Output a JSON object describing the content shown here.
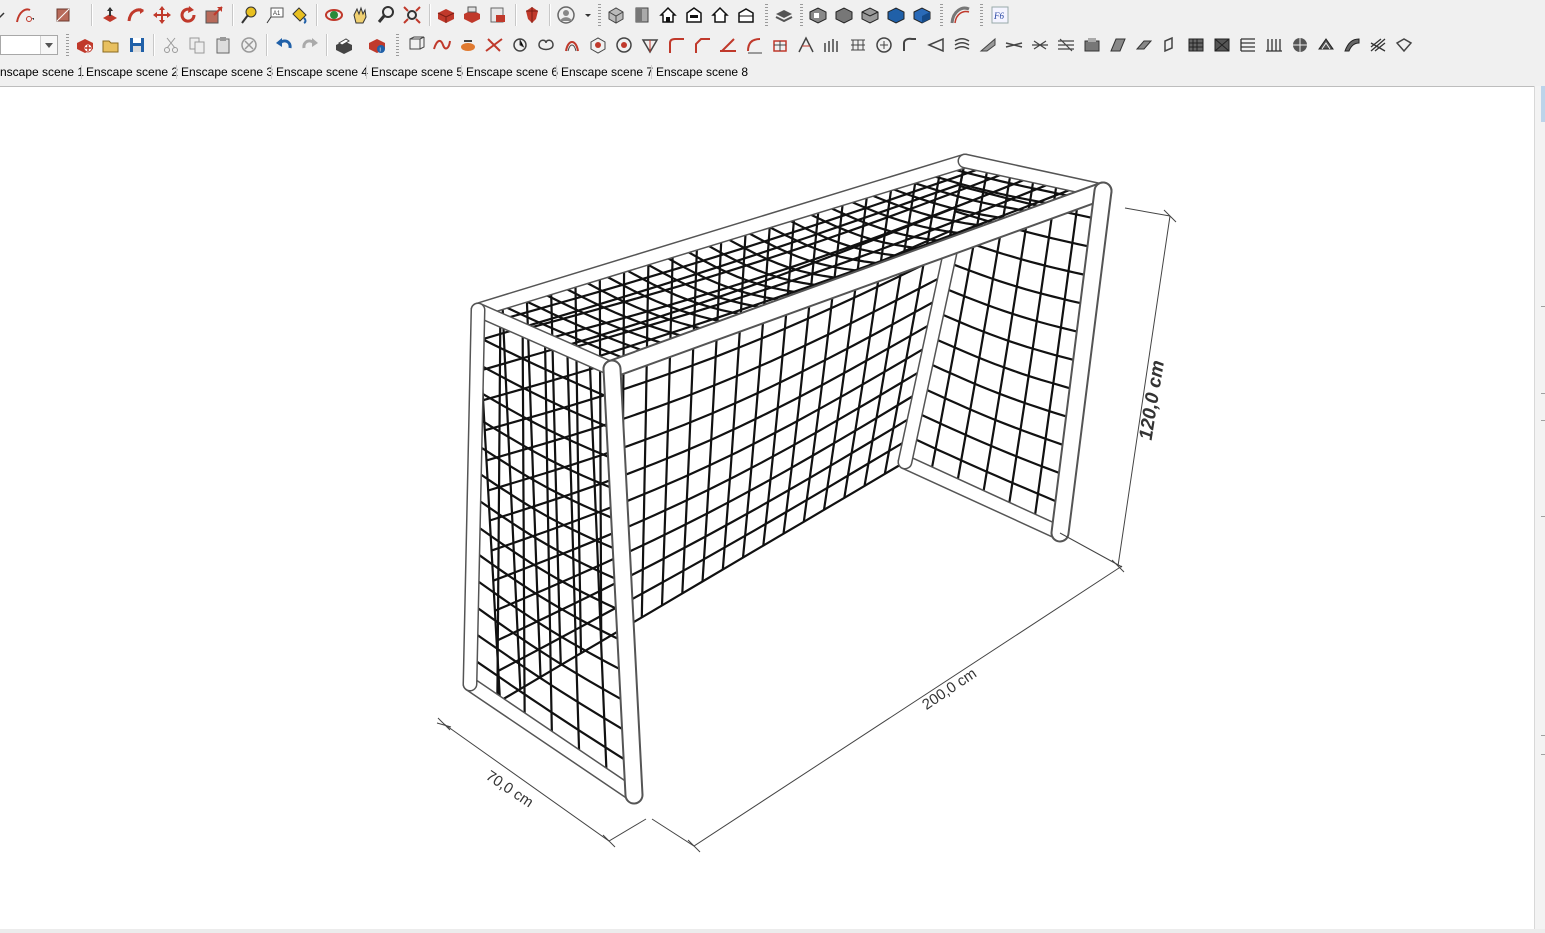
{
  "toolbar_top": {
    "groups": [
      {
        "name": "drawing-tools",
        "icons": [
          "line-dropdown-icon",
          "arc-dropdown-icon",
          "shape-dropdown-icon"
        ]
      },
      {
        "name": "edit-tools",
        "icons": [
          "push-pull-icon",
          "follow-me-icon",
          "move-icon",
          "rotate-icon",
          "scale-icon"
        ]
      },
      {
        "name": "construction-tools",
        "icons": [
          "tape-measure-icon",
          "text-label-icon",
          "paint-bucket-icon"
        ]
      },
      {
        "name": "camera-tools",
        "icons": [
          "orbit-icon",
          "pan-icon",
          "zoom-icon",
          "zoom-extents-icon"
        ]
      },
      {
        "name": "warehouse-tools",
        "icons": [
          "3d-warehouse-icon",
          "extension-warehouse-icon",
          "share-model-icon"
        ]
      },
      {
        "name": "ruby-tools",
        "icons": [
          "ruby-console-icon"
        ]
      },
      {
        "name": "account",
        "icons": [
          "user-account-dropdown-icon"
        ]
      },
      {
        "name": "standard-views",
        "icons": [
          "iso-view-icon",
          "top-view-icon",
          "front-view-icon",
          "right-view-icon",
          "back-view-icon",
          "left-view-icon"
        ]
      },
      {
        "name": "layers",
        "icons": [
          "layers-icon"
        ]
      },
      {
        "name": "styles",
        "icons": [
          "xray-icon",
          "back-edges-icon",
          "wireframe-icon",
          "hidden-line-icon",
          "shaded-icon"
        ]
      },
      {
        "name": "sandbox",
        "icons": [
          "sandbox-curve-icon"
        ]
      },
      {
        "name": "plugin",
        "icons": [
          "plugin-f6-icon"
        ]
      }
    ]
  },
  "toolbar_second": {
    "layer_combo_value": "",
    "groups": [
      {
        "name": "file-tools",
        "icons": [
          "new-model-icon",
          "open-icon",
          "save-icon"
        ]
      },
      {
        "name": "clipboard-tools",
        "icons": [
          "cut-icon",
          "copy-icon",
          "paste-icon",
          "erase-icon"
        ]
      },
      {
        "name": "history-tools",
        "icons": [
          "undo-icon",
          "redo-icon"
        ]
      },
      {
        "name": "print-tools",
        "icons": [
          "print-icon",
          "model-info-icon"
        ]
      },
      {
        "name": "solid-tools",
        "icons": [
          "outer-shell-icon",
          "intersect-icon",
          "union-icon",
          "subtract-icon",
          "trim-icon",
          "split-icon",
          "solid-3-icon",
          "solid-4-icon",
          "solid-5-icon",
          "solid-6-icon",
          "fillet-icon",
          "chamfer-icon",
          "bevel-icon",
          "round-corner-icon",
          "extrude-icon",
          "loft-icon",
          "stair-icon",
          "rail-icon",
          "curve-icon",
          "sweep-icon",
          "profile-icon",
          "section-icon",
          "flip-icon",
          "mirror-icon",
          "align-icon",
          "slice-icon",
          "array-icon",
          "stack-icon",
          "shell-icon",
          "offset-icon",
          "surface-icon",
          "quad-icon",
          "hatch-icon",
          "bars-icon",
          "grid-icon",
          "texture-icon",
          "box-icon"
        ]
      }
    ]
  },
  "scene_tabs": [
    "nscape scene 1",
    "Enscape scene 2",
    "Enscape scene 3",
    "Enscape scene 4",
    "Enscape scene 5",
    "Enscape scene 6",
    "Enscape scene 7",
    "Enscape scene 8"
  ],
  "model": {
    "object": "goal-frame-with-net",
    "frame_color": "#ffffff",
    "net_color": "#111111",
    "dimensions": {
      "height": "120,0 cm",
      "width": "200,0 cm",
      "depth": "70,0 cm"
    }
  },
  "colors": {
    "toolbar_bg": "#f0f0f0",
    "viewport_bg": "#ffffff",
    "icon_red": "#c0392b",
    "icon_blue": "#2060a8",
    "icon_dark": "#3a3a3a"
  }
}
